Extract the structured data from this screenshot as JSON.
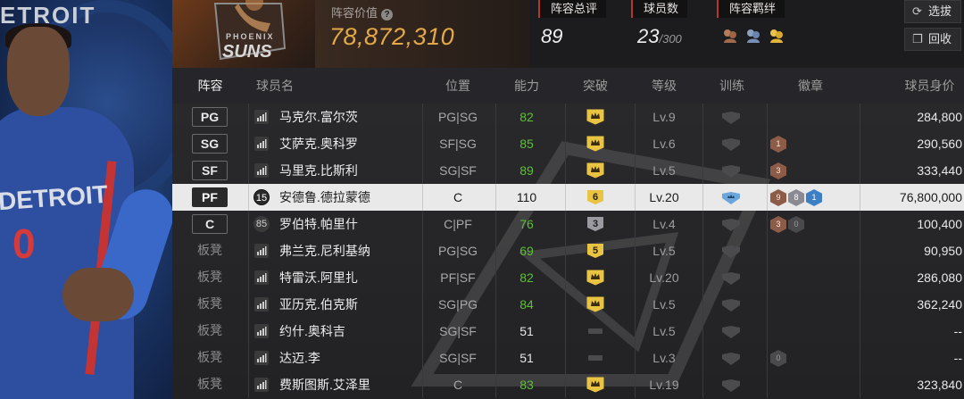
{
  "header": {
    "value_label": "阵容价值",
    "value": "78,872,310",
    "stats": [
      {
        "label": "阵容总评",
        "value": "89"
      },
      {
        "label": "球员数",
        "value": "23",
        "sub": "/300"
      },
      {
        "label": "阵容羁绊",
        "value": ""
      }
    ],
    "buttons": [
      {
        "label": "选拔",
        "icon": "refresh-icon"
      },
      {
        "label": "回收",
        "icon": "copy-icon"
      }
    ]
  },
  "player_art": {
    "jersey_text": "DETROIT",
    "jersey_number": "0",
    "bg_text": "ETROIT"
  },
  "team_logo": {
    "text1": "PHOENIX",
    "text2": "SUNS"
  },
  "table": {
    "columns": [
      "阵容",
      "球员名",
      "位置",
      "能力",
      "突破",
      "等级",
      "训练",
      "徽章",
      "球员身价"
    ],
    "rows": [
      {
        "lineup": "PG",
        "bench": false,
        "rank_icon": "signal-icon",
        "rank": "",
        "name": "马克尔.富尔茨",
        "pos": "PG|SG",
        "ovr": "82",
        "ovr_color": "green",
        "break": "crown",
        "level": "Lv.9",
        "train": "gray",
        "badges": [],
        "value": "284,800"
      },
      {
        "lineup": "SG",
        "bench": false,
        "rank_icon": "signal-icon",
        "rank": "",
        "name": "艾萨克.奥科罗",
        "pos": "SF|SG",
        "ovr": "85",
        "ovr_color": "green",
        "break": "crown",
        "level": "Lv.6",
        "train": "gray",
        "badges": [
          {
            "type": "bronze",
            "text": "1"
          }
        ],
        "value": "290,560"
      },
      {
        "lineup": "SF",
        "bench": false,
        "rank_icon": "signal-icon",
        "rank": "",
        "name": "马里克.比斯利",
        "pos": "SG|SF",
        "ovr": "89",
        "ovr_color": "green",
        "break": "crown",
        "level": "Lv.5",
        "train": "gray",
        "badges": [
          {
            "type": "bronze",
            "text": "3"
          }
        ],
        "value": "333,440"
      },
      {
        "lineup": "PF",
        "bench": false,
        "selected": true,
        "rank_icon": "",
        "rank": "15",
        "name": "安德鲁.德拉蒙德",
        "pos": "C",
        "ovr": "110",
        "ovr_color": "dark",
        "break": "6",
        "level": "Lv.20",
        "train": "blue",
        "badges": [
          {
            "type": "bronze",
            "text": "9"
          },
          {
            "type": "silver",
            "text": "8"
          },
          {
            "type": "blue",
            "text": "1"
          }
        ],
        "value": "76,800,000"
      },
      {
        "lineup": "C",
        "bench": false,
        "rank_icon": "",
        "rank": "85",
        "name": "罗伯特.帕里什",
        "pos": "C|PF",
        "ovr": "76",
        "ovr_color": "green",
        "break": "3",
        "level": "Lv.4",
        "train": "gray",
        "badges": [
          {
            "type": "bronze",
            "text": "3"
          },
          {
            "type": "gray",
            "text": "0"
          }
        ],
        "value": "100,400"
      },
      {
        "lineup": "板凳",
        "bench": true,
        "rank_icon": "signal-icon",
        "rank": "",
        "name": "弗兰克.尼利基纳",
        "pos": "PG|SG",
        "ovr": "69",
        "ovr_color": "green",
        "break": "5",
        "level": "Lv.5",
        "train": "gray",
        "badges": [],
        "value": "90,950"
      },
      {
        "lineup": "板凳",
        "bench": true,
        "rank_icon": "signal-icon",
        "rank": "",
        "name": "特雷沃.阿里扎",
        "pos": "PF|SF",
        "ovr": "82",
        "ovr_color": "green",
        "break": "crown",
        "level": "Lv.20",
        "train": "gray",
        "badges": [],
        "value": "286,080"
      },
      {
        "lineup": "板凳",
        "bench": true,
        "rank_icon": "signal-icon",
        "rank": "",
        "name": "亚历克.伯克斯",
        "pos": "SG|PG",
        "ovr": "84",
        "ovr_color": "green",
        "break": "crown",
        "level": "Lv.5",
        "train": "gray",
        "badges": [],
        "value": "362,240"
      },
      {
        "lineup": "板凳",
        "bench": true,
        "rank_icon": "signal-icon",
        "rank": "",
        "name": "约什.奥科吉",
        "pos": "SG|SF",
        "ovr": "51",
        "ovr_color": "white",
        "break": "none",
        "level": "Lv.5",
        "train": "gray",
        "badges": [],
        "value": "--"
      },
      {
        "lineup": "板凳",
        "bench": true,
        "rank_icon": "signal-icon",
        "rank": "",
        "name": "达迈.李",
        "pos": "SG|SF",
        "ovr": "51",
        "ovr_color": "white",
        "break": "none",
        "level": "Lv.3",
        "train": "gray",
        "badges": [
          {
            "type": "gray",
            "text": "0"
          }
        ],
        "value": "--"
      },
      {
        "lineup": "板凳",
        "bench": true,
        "rank_icon": "signal-icon",
        "rank": "",
        "name": "费斯图斯.艾泽里",
        "pos": "C",
        "ovr": "83",
        "ovr_color": "green",
        "break": "crown",
        "level": "Lv.19",
        "train": "gray",
        "badges": [],
        "value": "323,840"
      }
    ]
  }
}
